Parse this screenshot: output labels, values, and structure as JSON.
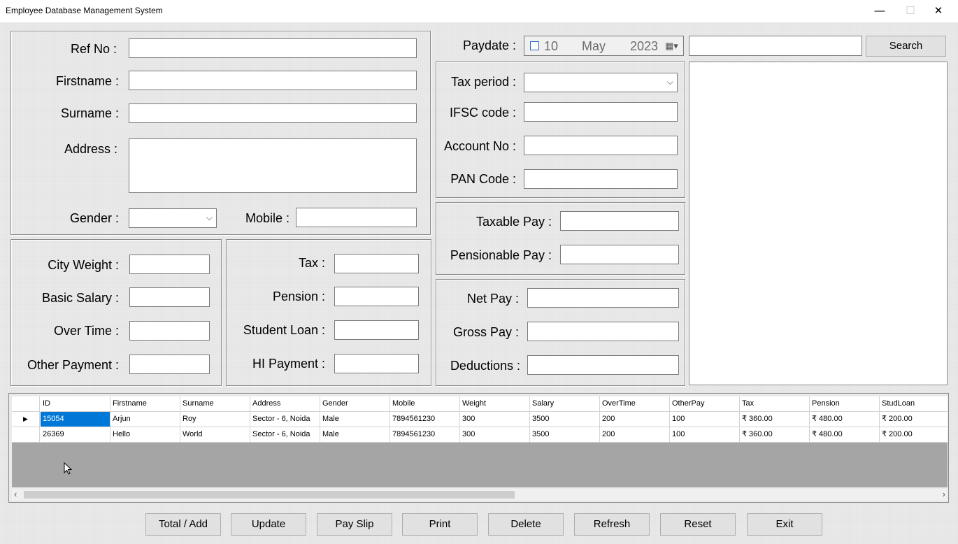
{
  "window": {
    "title": "Employee Database Management System",
    "minimize": "—",
    "maximize": "☐",
    "close": "✕"
  },
  "personal": {
    "ref_label": "Ref No :",
    "firstname_label": "Firstname :",
    "surname_label": "Surname :",
    "address_label": "Address :",
    "gender_label": "Gender :",
    "mobile_label": "Mobile :"
  },
  "payment": {
    "city_weight_label": "City Weight :",
    "basic_salary_label": "Basic Salary :",
    "over_time_label": "Over Time :",
    "other_payment_label": "Other Payment :"
  },
  "deductions_box": {
    "tax_label": "Tax :",
    "pension_label": "Pension :",
    "student_loan_label": "Student Loan :",
    "hi_payment_label": "HI Payment :"
  },
  "paydate": {
    "label": "Paydate :",
    "day": "10",
    "month": "May",
    "year": "2023"
  },
  "search": {
    "button": "Search"
  },
  "tax_info": {
    "tax_period_label": "Tax period :",
    "ifsc_label": "IFSC code :",
    "account_label": "Account No :",
    "pan_label": "PAN Code :"
  },
  "pay": {
    "taxable_label": "Taxable Pay :",
    "pensionable_label": "Pensionable Pay :",
    "net_label": "Net Pay :",
    "gross_label": "Gross Pay :",
    "deductions_label": "Deductions :"
  },
  "grid": {
    "columns": [
      "ID",
      "Firstname",
      "Surname",
      "Address",
      "Gender",
      "Mobile",
      "Weight",
      "Salary",
      "OverTime",
      "OtherPay",
      "Tax",
      "Pension",
      "StudLoan"
    ],
    "rows": [
      [
        "15054",
        "Arjun",
        "Roy",
        "Sector - 6, Noida",
        "Male",
        "7894561230",
        "300",
        "3500",
        "200",
        "100",
        "₹ 360.00",
        "₹ 480.00",
        "₹ 200.00"
      ],
      [
        "26369",
        "Hello",
        "World",
        "Sector - 6, Noida",
        "Male",
        "7894561230",
        "300",
        "3500",
        "200",
        "100",
        "₹ 360.00",
        "₹ 480.00",
        "₹ 200.00"
      ]
    ],
    "current_row_marker": "▶"
  },
  "buttons": {
    "total_add": "Total / Add",
    "update": "Update",
    "pay_slip": "Pay Slip",
    "print": "Print",
    "delete": "Delete",
    "refresh": "Refresh",
    "reset": "Reset",
    "exit": "Exit"
  }
}
